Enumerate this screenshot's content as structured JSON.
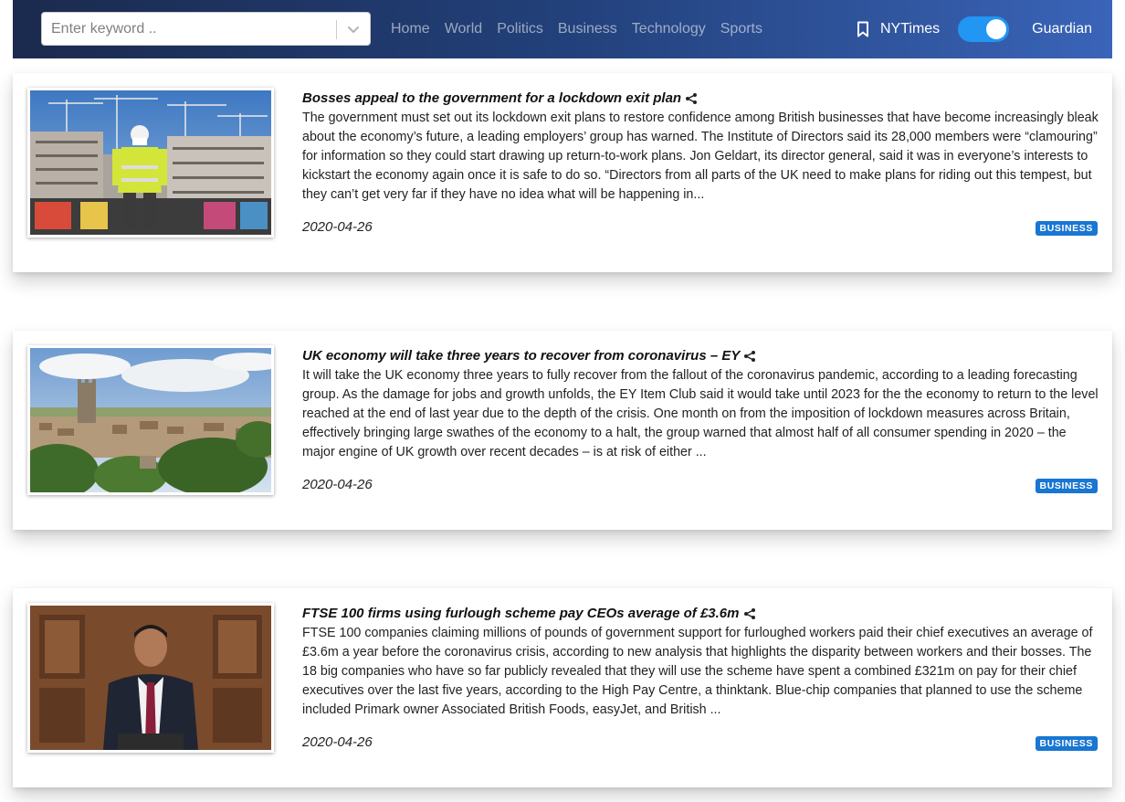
{
  "search": {
    "placeholder": "Enter keyword .."
  },
  "nav": {
    "links": [
      "Home",
      "World",
      "Politics",
      "Business",
      "Technology",
      "Sports"
    ]
  },
  "sources": {
    "left": "NYTimes",
    "right": "Guardian",
    "toggle_on": true
  },
  "icons": {
    "search_dropdown": "chevron-down-icon",
    "bookmark": "bookmark-icon",
    "share": "share-icon"
  },
  "colors": {
    "badge": "#1976d2",
    "toggle": "#2196f3"
  },
  "articles": [
    {
      "title": "Bosses appeal to the government for a lockdown exit plan",
      "description": "The government must set out its lockdown exit plans to restore confidence among British businesses that have become increasingly bleak about the economy’s future, a leading employers’ group has warned. The Institute of Directors said its 28,000 members were “clamouring” for information so they could start drawing up return-to-work plans. Jon Geldart, its director general, said it was in everyone’s interests to kickstart the economy again once it is safe to do so. “Directors from all parts of the UK need to make plans for riding out this tempest, but they can’t get very far if they have no idea what will be happening in...",
      "date": "2020-04-26",
      "section": "BUSINESS",
      "image": "construction-worker-photo"
    },
    {
      "title": "UK economy will take three years to recover from coronavirus – EY",
      "description": "It will take the UK economy three years to fully recover from the fallout of the coronavirus pandemic, according to a leading forecasting group. As the damage for jobs and growth unfolds, the EY Item Club said it would take until 2023 for the the economy to return to the level reached at the end of last year due to the depth of the crisis. One month on from the imposition of lockdown measures across Britain, effectively bringing large swathes of the economy to a halt, the group warned that almost half of all consumer spending in 2020 – the major engine of UK growth over recent decades – is at risk of either ...",
      "date": "2020-04-26",
      "section": "BUSINESS",
      "image": "town-landscape-photo"
    },
    {
      "title": "FTSE 100 firms using furlough scheme pay CEOs average of £3.6m",
      "description": "FTSE 100 companies claiming millions of pounds of government support for furloughed workers paid their chief executives an average of £3.6m a year before the coronavirus crisis, according to new analysis that highlights the disparity between workers and their bosses. The 18 big companies who have so far publicly revealed that they will use the scheme have spent a combined £321m on pay for their chief executives over the last five years, according to the High Pay Centre, a thinktank. Blue-chip companies that planned to use the scheme included Primark owner Associated British Foods, easyJet, and British ...",
      "date": "2020-04-26",
      "section": "BUSINESS",
      "image": "man-at-podium-photo"
    }
  ]
}
